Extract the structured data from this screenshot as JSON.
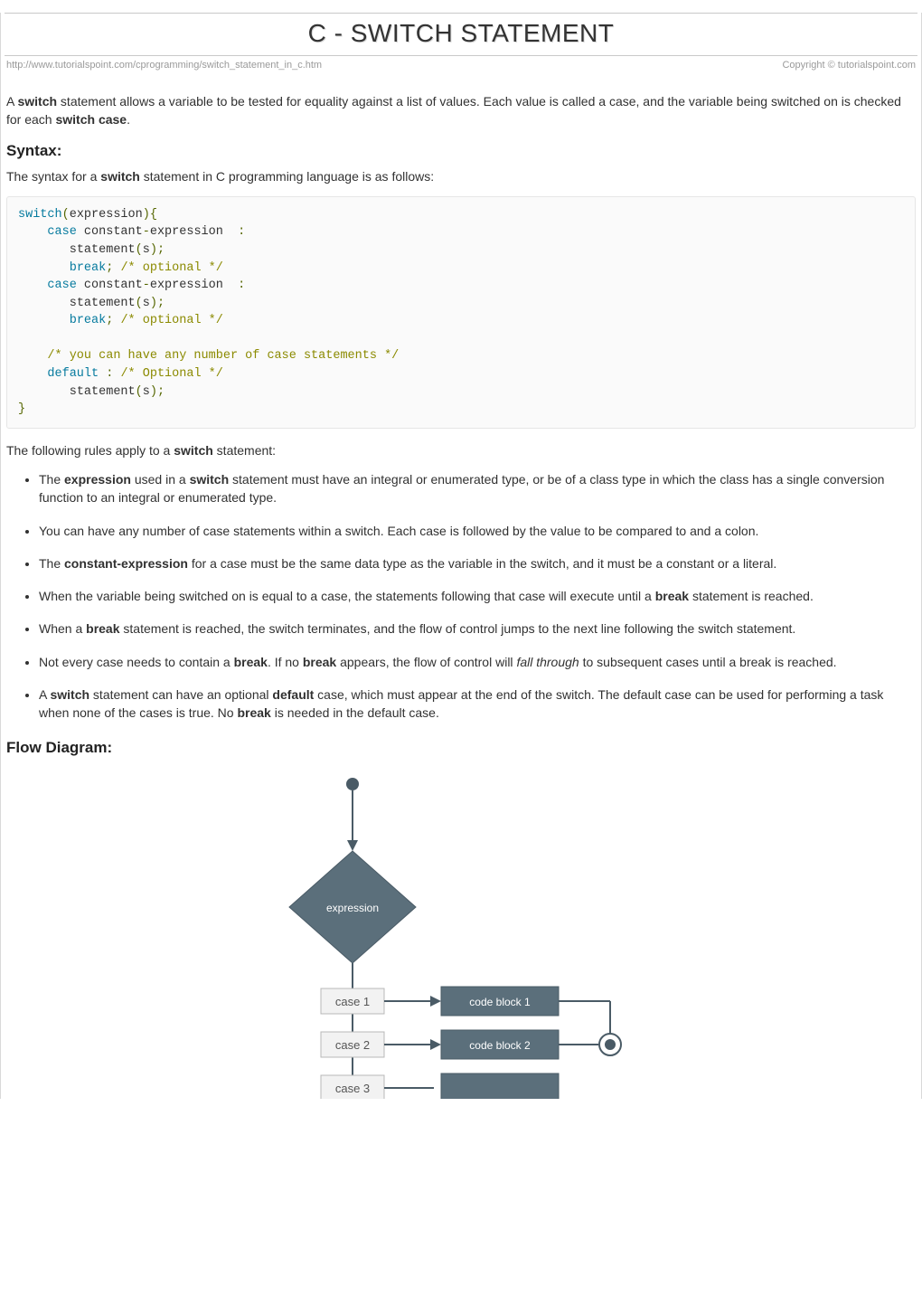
{
  "title": "C - SWITCH STATEMENT",
  "url": "http://www.tutorialspoint.com/cprogramming/switch_statement_in_c.htm",
  "copyright": "Copyright © tutorialspoint.com",
  "intro": {
    "pre1": "A ",
    "b1": "switch",
    "mid1": " statement allows a variable to be tested for equality against a list of values. Each value is called a case, and the variable being switched on is checked for each ",
    "b2": "switch case",
    "post1": "."
  },
  "syntax_heading": "Syntax:",
  "syntax_intro": {
    "pre": "The syntax for a ",
    "b": "switch",
    "post": " statement in C programming language is as follows:"
  },
  "code": {
    "kw_switch": "switch",
    "lparen": "(",
    "expr": "expression",
    "rparen_brace": "){",
    "indent1": "    ",
    "kw_case": "case",
    "sp": " ",
    "const": "constant",
    "dash": "-",
    "expr2": "expression  ",
    "colon": ":",
    "indent2": "       ",
    "stmt": "statement",
    "lparen2": "(",
    "s": "s",
    "rparen_semi": ");",
    "kw_break": "break",
    "semi_sp": ";",
    "cmt_opt": "/* optional */",
    "cmt_any": "/* you can have any number of case statements */",
    "kw_default": "default",
    "colon_sp": " :",
    "cmt_Opt": "/* Optional */",
    "rbrace": "}"
  },
  "rules_intro": {
    "pre": "The following rules apply to a ",
    "b": "switch",
    "post": " statement:"
  },
  "rules": [
    {
      "pre": "The ",
      "b1": "expression",
      "mid": " used in a ",
      "b2": "switch",
      "post": " statement must have an integral or enumerated type, or be of a class type in which the class has a single conversion function to an integral or enumerated type."
    },
    {
      "text": "You can have any number of case statements within a switch. Each case is followed by the value to be compared to and a colon."
    },
    {
      "pre": "The ",
      "b1": "constant-expression",
      "post": " for a case must be the same data type as the variable in the switch, and it must be a constant or a literal."
    },
    {
      "pre": "When the variable being switched on is equal to a case, the statements following that case will execute until a ",
      "b1": "break",
      "post": " statement is reached."
    },
    {
      "pre": "When a ",
      "b1": "break",
      "post": " statement is reached, the switch terminates, and the flow of control jumps to the next line following the switch statement."
    },
    {
      "pre": "Not every case needs to contain a ",
      "b1": "break",
      "mid": ". If no ",
      "b2": "break",
      "post_pre": " appears, the flow of control will ",
      "i": "fall through",
      "post": " to subsequent cases until a break is reached."
    },
    {
      "pre": "A ",
      "b1": "switch",
      "mid": " statement can have an optional ",
      "b2": "default",
      "post_pre": " case, which must appear at the end of the switch. The default case can be used for performing a task when none of the cases is true. No ",
      "b3": "break",
      "post": " is needed in the default case."
    }
  ],
  "flow_heading": "Flow Diagram:",
  "flow": {
    "expression": "expression",
    "case1": "case 1",
    "case2": "case 2",
    "case3": "case 3",
    "block1": "code block 1",
    "block2": "code block 2"
  }
}
